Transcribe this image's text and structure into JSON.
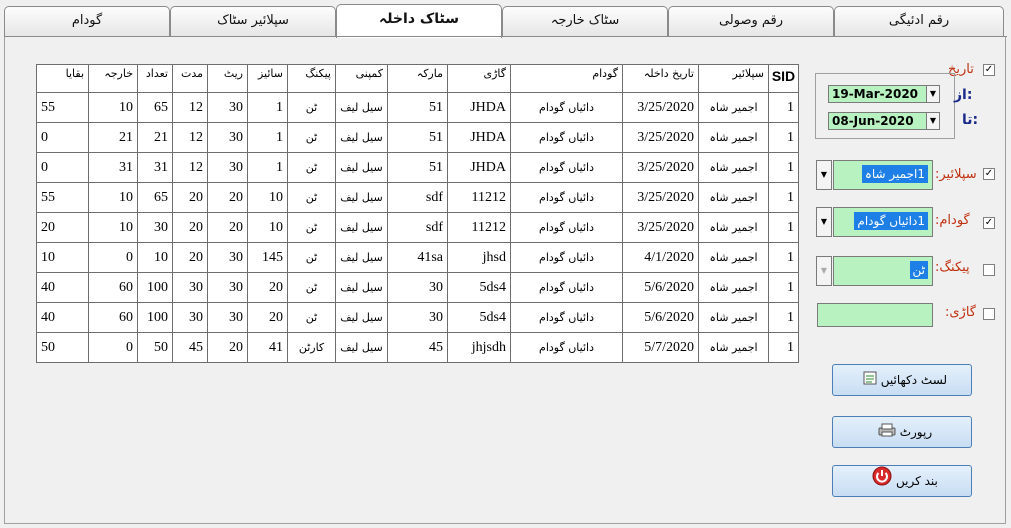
{
  "tabs": [
    "رقم ادئیگی",
    "رقم وصولی",
    "سٹاک خارجہ",
    "سٹاک داخلہ",
    "سپلائیر سٹاک",
    "گودام"
  ],
  "active_tab": "سٹاک داخلہ",
  "grid": {
    "headers": [
      "SID",
      "سپلائیر",
      "تاریخ داخلہ",
      "گودام",
      "گاڑی",
      "مارکہ",
      "کمپنی",
      "پیکنگ",
      "سائیز",
      "ریٹ",
      "مدت",
      "تعداد",
      "خارجہ",
      "بقایا"
    ],
    "rows": [
      [
        "1",
        "اجمیر شاہ",
        "3/25/2020",
        "دائیاں گودام",
        "JHDA",
        "51",
        "سیل لیف",
        "ٹن",
        "1",
        "30",
        "12",
        "65",
        "10",
        "55"
      ],
      [
        "1",
        "اجمیر شاہ",
        "3/25/2020",
        "دائیاں گودام",
        "JHDA",
        "51",
        "سیل لیف",
        "ٹن",
        "1",
        "30",
        "12",
        "21",
        "21",
        "0"
      ],
      [
        "1",
        "اجمیر شاہ",
        "3/25/2020",
        "دائیاں گودام",
        "JHDA",
        "51",
        "سیل لیف",
        "ٹن",
        "1",
        "30",
        "12",
        "31",
        "31",
        "0"
      ],
      [
        "1",
        "اجمیر شاہ",
        "3/25/2020",
        "دائیاں گودام",
        "11212",
        "sdf",
        "سیل لیف",
        "ٹن",
        "10",
        "20",
        "20",
        "65",
        "10",
        "55"
      ],
      [
        "1",
        "اجمیر شاہ",
        "3/25/2020",
        "دائیاں گودام",
        "11212",
        "sdf",
        "سیل لیف",
        "ٹن",
        "10",
        "20",
        "20",
        "30",
        "10",
        "20"
      ],
      [
        "1",
        "اجمیر شاہ",
        "4/1/2020",
        "دائیاں گودام",
        "jhsd",
        "41sa",
        "سیل لیف",
        "ٹن",
        "145",
        "30",
        "20",
        "10",
        "0",
        "10"
      ],
      [
        "1",
        "اجمیر شاہ",
        "5/6/2020",
        "دائیاں گودام",
        "5ds4",
        "30",
        "سیل لیف",
        "ٹن",
        "20",
        "30",
        "30",
        "100",
        "60",
        "40"
      ],
      [
        "1",
        "اجمیر شاہ",
        "5/6/2020",
        "دائیاں گودام",
        "5ds4",
        "30",
        "سیل لیف",
        "ٹن",
        "20",
        "30",
        "30",
        "100",
        "60",
        "40"
      ],
      [
        "1",
        "اجمیر شاہ",
        "5/7/2020",
        "دائیاں گودام",
        "jhjsdh",
        "45",
        "سیل لیف",
        "کارٹن",
        "41",
        "20",
        "45",
        "50",
        "0",
        "50"
      ]
    ]
  },
  "filters": {
    "date_label": "تاریخ",
    "from_label": "از:",
    "to_label": "تا:",
    "from_date": "19-Mar-2020",
    "to_date": "08-Jun-2020",
    "supplier_label": "سپلائیر:",
    "supplier_value": "1اجمیر شاہ",
    "warehouse_label": "گودام:",
    "warehouse_value": "1دائیاں گودام",
    "packing_label": "پیکنگ:",
    "packing_value": "ٹن",
    "vehicle_label": "گاڑی:",
    "vehicle_value": ""
  },
  "buttons": {
    "show_list": "لسٹ دکھائیں",
    "report": "رپورٹ",
    "close": "بند کریں"
  },
  "colors": {
    "field_green": "#b8f2c0",
    "label_orange": "#c03010",
    "selection_blue": "#1e7fe6"
  }
}
